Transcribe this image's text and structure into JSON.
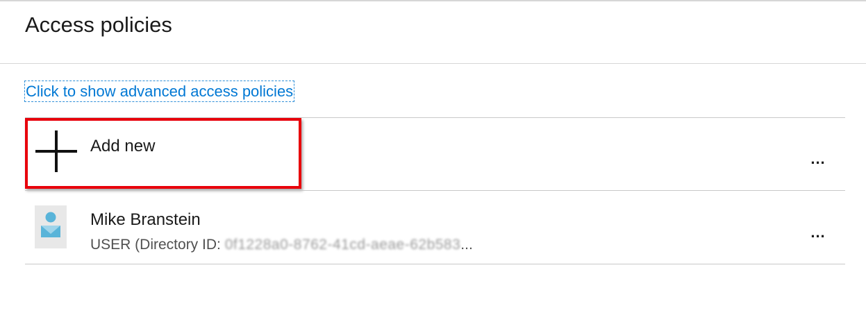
{
  "page": {
    "title": "Access policies"
  },
  "advanced_link": {
    "label": "Click to show advanced access policies"
  },
  "add_new": {
    "label": "Add new",
    "more": "..."
  },
  "users": [
    {
      "name": "Mike Branstein",
      "type_label": "USER (Directory ID: ",
      "directory_id": "0f1228a0-8762-41cd-aeae-62b583",
      "truncation": "...",
      "more": "..."
    }
  ],
  "colors": {
    "link": "#0078d4",
    "highlight": "#e8000b",
    "divider": "#c8c8c8"
  },
  "icons": {
    "add": "plus-icon",
    "avatar": "user-avatar-icon",
    "more": "more-options-icon"
  }
}
